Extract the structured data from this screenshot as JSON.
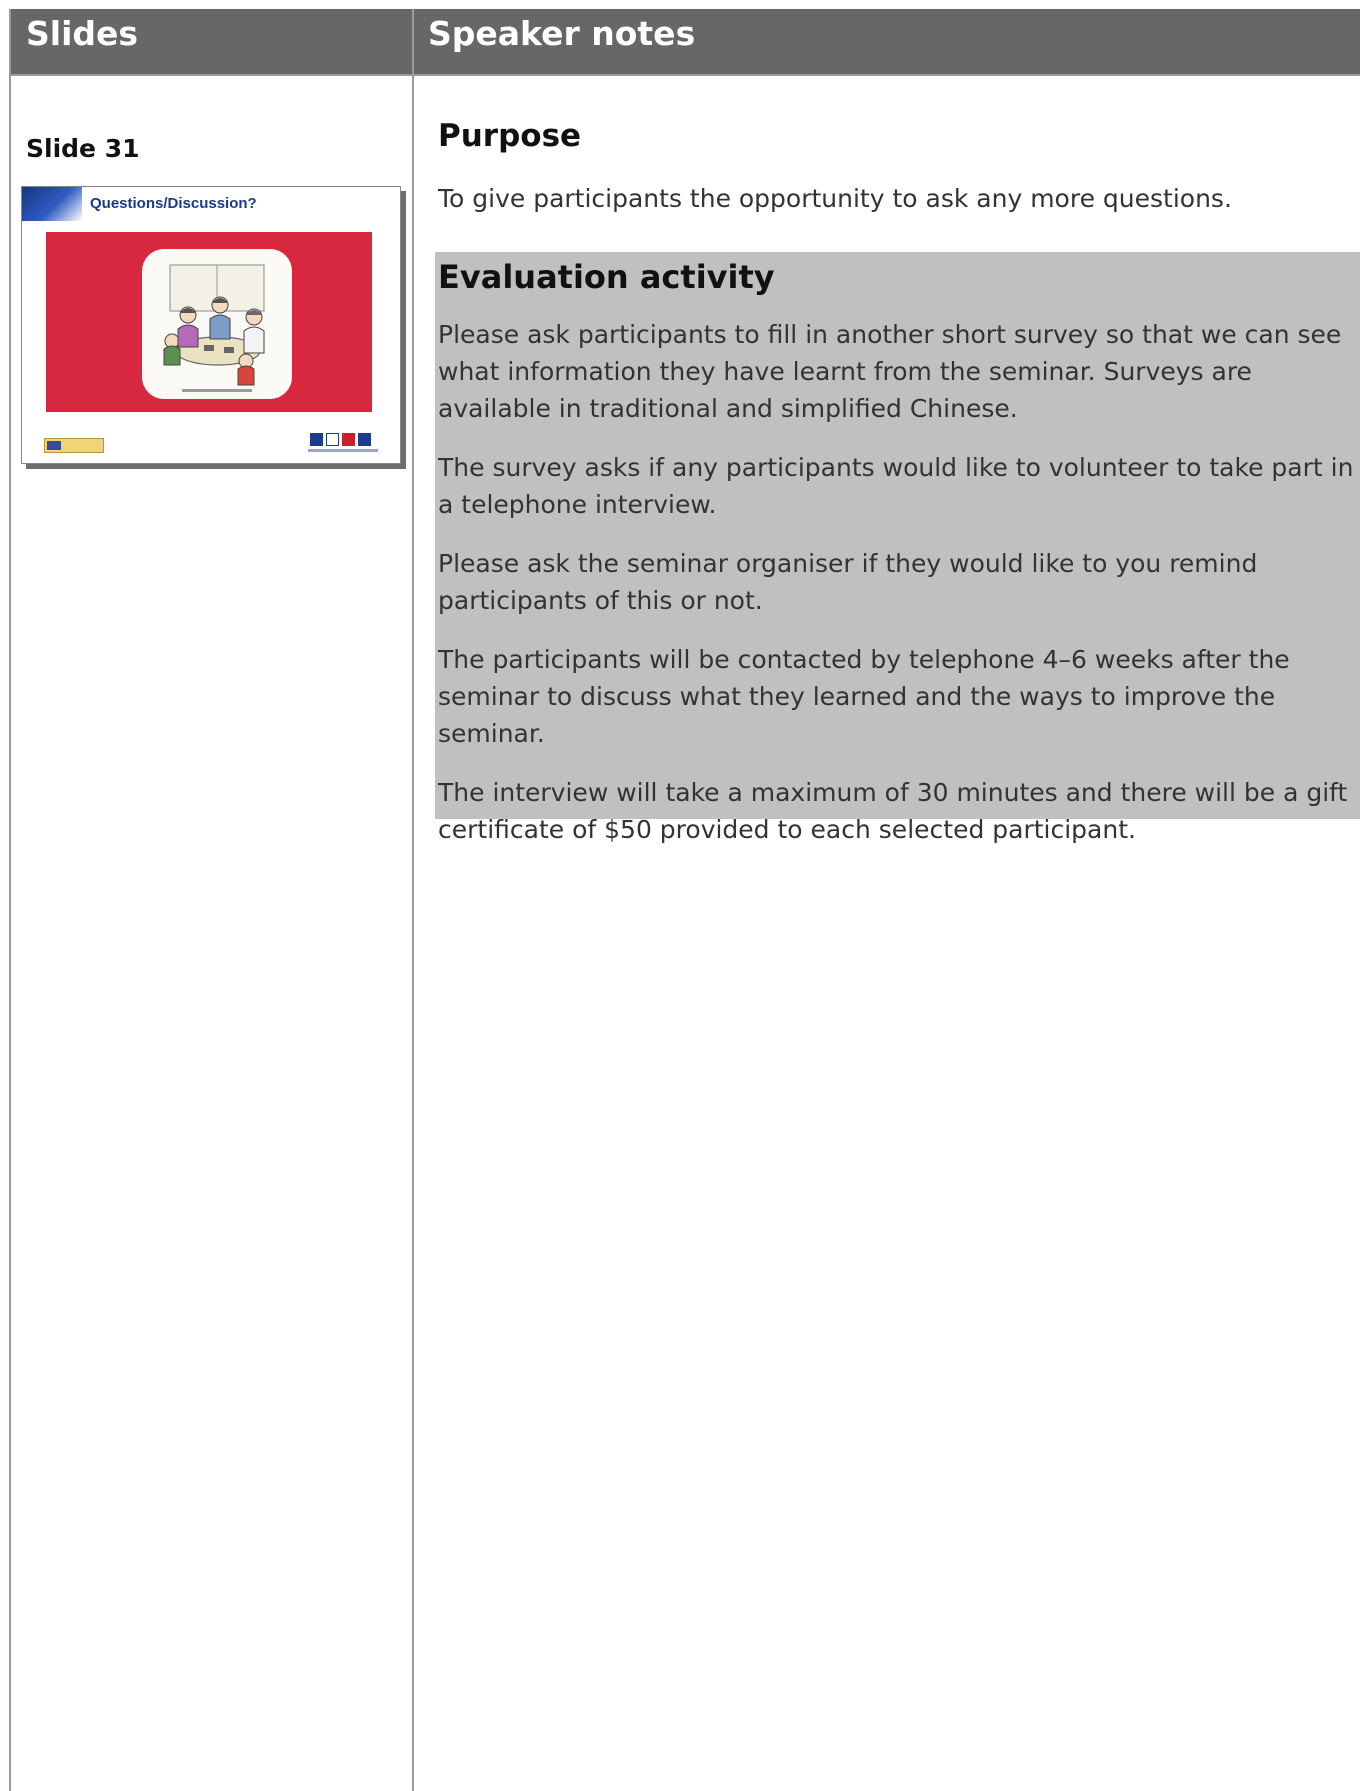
{
  "header": {
    "slides_label": "Slides",
    "notes_label": "Speaker notes"
  },
  "slide": {
    "label": "Slide 31",
    "thumbnail": {
      "title": "Questions/Discussion?",
      "accent_color": "#d7283f",
      "brand_color": "#1c3a8c"
    }
  },
  "notes": {
    "purpose_heading": "Purpose",
    "purpose_text": "To give participants the opportunity to ask any more questions.",
    "evaluation_heading": "Evaluation activity",
    "evaluation_paragraphs": [
      "Please ask participants to fill in another short survey so that we can see what information they have learnt from the seminar. Surveys are available in traditional and simplified Chinese.",
      "The survey asks if any participants would like to volunteer to take part in a telephone interview.",
      "Please ask the seminar organiser if they would like to you remind participants of this or not.",
      "The participants will be contacted by telephone 4–6 weeks after the seminar to discuss what they learned and the ways to improve the seminar.",
      "The interview will take a maximum of 30 minutes and there will be a gift certificate of $50 provided to each selected participant."
    ]
  }
}
